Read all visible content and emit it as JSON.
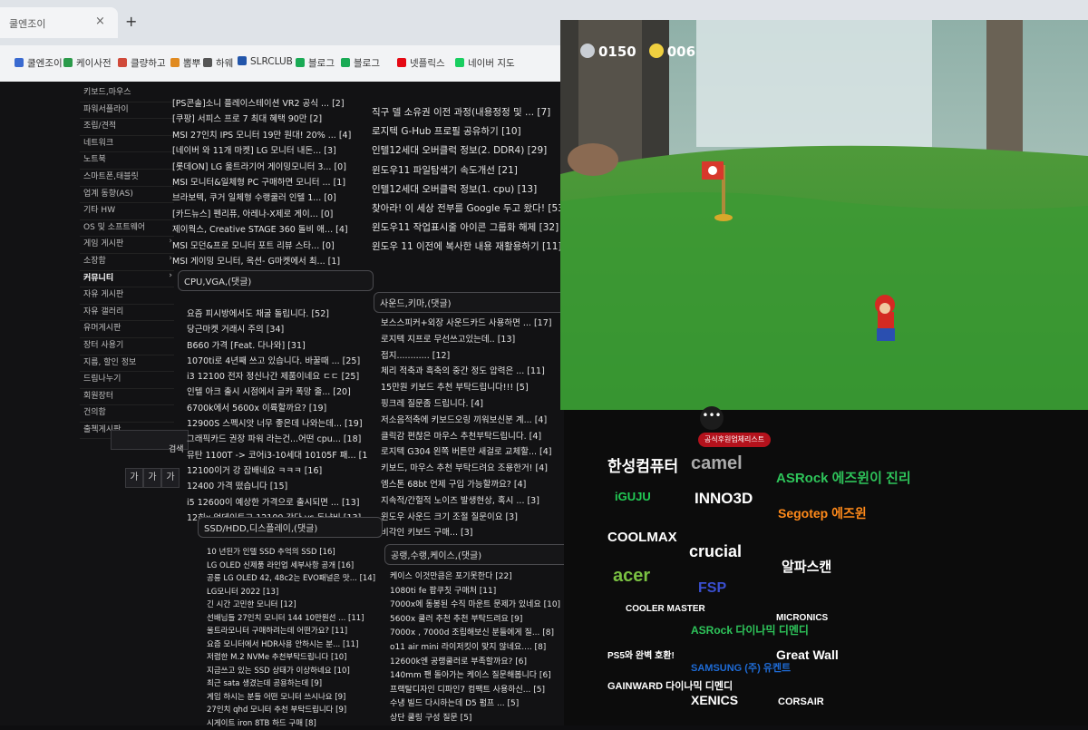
{
  "browser": {
    "tab_title": "쿨엔조이",
    "tab_close": "×",
    "new_tab": "+",
    "bookmarks": [
      {
        "label": "쿨엔조이",
        "color": "#3a6ad0"
      },
      {
        "label": "케이사전",
        "color": "#2b9a4a"
      },
      {
        "label": "클량하고",
        "color": "#d04a3a"
      },
      {
        "label": "뽐뿌",
        "color": "#e08a20"
      },
      {
        "label": "하웨",
        "color": "#555555"
      },
      {
        "label": "SLRCLUB",
        "color": "#2255aa"
      },
      {
        "label": "블로그",
        "color": "#1aaa55"
      },
      {
        "label": "블로그",
        "color": "#1aaa55"
      },
      {
        "label": "넷플릭스",
        "color": "#e50914"
      },
      {
        "label": "네이버 지도",
        "color": "#19ce60"
      }
    ]
  },
  "sidebar": {
    "items": [
      {
        "label": "키보드,마우스",
        "arrow": ""
      },
      {
        "label": "파워서플라이",
        "arrow": ""
      },
      {
        "label": "조립/견적",
        "arrow": ""
      },
      {
        "label": "네트워크",
        "arrow": ""
      },
      {
        "label": "노트북",
        "arrow": ""
      },
      {
        "label": "스마트폰,태블릿",
        "arrow": ""
      },
      {
        "label": "업계 동향(AS)",
        "arrow": ""
      },
      {
        "label": "기타 HW",
        "arrow": ""
      },
      {
        "label": "OS 및 소프트웨어",
        "arrow": ""
      },
      {
        "label": "게임 게시판",
        "arrow": "›"
      },
      {
        "label": "소장함",
        "arrow": "›"
      },
      {
        "label": "커뮤니티",
        "arrow": "›"
      },
      {
        "label": "자유 게시판",
        "arrow": ""
      },
      {
        "label": "자유 갤러리",
        "arrow": ""
      },
      {
        "label": "유머게시판",
        "arrow": ""
      },
      {
        "label": "장터 사용기",
        "arrow": ""
      },
      {
        "label": "지름, 할인 정보",
        "arrow": ""
      },
      {
        "label": "드림나누기",
        "arrow": ""
      },
      {
        "label": "회원장터",
        "arrow": ""
      },
      {
        "label": "건의함",
        "arrow": ""
      },
      {
        "label": "출첵게시판",
        "arrow": ""
      }
    ],
    "active_index": 11,
    "search_button": "검색",
    "pager": [
      "가",
      "가",
      "가"
    ]
  },
  "boards": {
    "top_left": [
      "[PS콘솔]소니 플레이스테이션 VR2 공식 ... [2]",
      "[쿠팡] 서피스 프로 7 최대 혜택 90만 [2]",
      "MSI 27인치 IPS 모니터 19만 원대! 20% ... [4]",
      "[네이버 와 11개 마켓] LG 모니터 내돈... [3]",
      "[롯데ON] LG 울트라기어 게이밍모니터 3... [0]",
      "MSI 모니터&일체형 PC 구매하면 모니터 ... [1]",
      "브라보텍, 쿠거 일체형 수랭쿨러 인텔 1... [0]",
      "[카드뉴스] 펜리퓨, 아레나-X제로 게이... [0]",
      "제이웍스, Creative STAGE 360 돌비 애... [4]",
      "MSI 모던&프로 모니터 포트 리뷰 스타... [0]",
      "MSI 게이밍 모니터, 옥션- G마켓에서 최... [1]"
    ],
    "top_right": [
      "직구 델 소유권 이전 과정(내용정정 및 ... [7]",
      "로지텍 G-Hub 프로필 공유하기 [10]",
      "인텔12세대 오버클럭 정보(2. DDR4) [29]",
      "윈도우11 파일탐색기 속도개선 [21]",
      "인텔12세대 오버클럭 정보(1. cpu) [13]",
      "찾아라! 이 세상 전부를 Google 두고 왔다! [53]",
      "윈도우11 작업표시줄 아이콘 그룹화 해제 [32]",
      "윈도우 11 이전에 복사한 내용 재활용하기 [11]"
    ],
    "cpu_title": "CPU,VGA,(댓글)",
    "cpu": [
      "요즘 피시방에서도 채굴 돌립니다. [52]",
      "당근마켓 거래시 주의 [34]",
      "B660 가격 [Feat. 다나와] [31]",
      "1070ti로 4년째 쓰고 있습니다. 바꿀때 ... [25]",
      "i3 12100 전자 정신나간 제품이네요 ㄷㄷ [25]",
      "인텔 아크 출시 시점에서 글카 폭망 줄... [20]",
      "6700k에서 5600x 이륙할까요? [19]",
      "12900S 스펙시앗 너무 좋은데 나와는데... [19]",
      "그래픽카드 권장 파워 라는건...어떤 cpu... [18]",
      "뮤탄 1100T -> 코어i3-10세대 10105F 패... [18]",
      "12100이거 강 잡배네요 ㅋㅋㅋ [16]",
      "12400 가격 떴습니다 [15]",
      "i5 12600이 예상한 가격으로 출시되면 ... [13]",
      "12히x 업데이트고 12100 간다 vs 돈냥비 [13]"
    ],
    "ssd_title": "SSD/HDD,디스플레이,(댓글)",
    "ssd": [
      "10 년된가 인텔 SSD 추억의 SSD [16]",
      "LG OLED 신제품 라인업 세부사항 공개 [16]",
      "공룡 LG OLED 42, 48c2는 EVO패널은 맛... [14]",
      "LG모니터 2022 [13]",
      "긴 시간 고민한 모니터 [12]",
      "선배님들 27인치 모니터 144 10만원선 ... [11]",
      "울트라모니터 구매하려는데 어떤가요? [11]",
      "요즘 모니터에서 HDR사용 안하시는 분... [11]",
      "저렴한 M.2 NVMe 추천부탁드립니다 [10]",
      "지금쓰고 있는 SSD 상태가 이상하네요 [10]",
      "최근 sata 생겼는데 공용하는데 [9]",
      "게임 하시는 분들 어떤 모니터 쓰시나요 [9]",
      "27인치 qhd 모니터 추천 부탁드립니다 [9]",
      "시게이트 iron 8TB 하드 구매 [8]"
    ],
    "sound_title": "사운드,키마,(댓글)",
    "sound": [
      "보스스피커+외장 사운드카드 사용하면 ... [17]",
      "로지텍 지프로 무선쓰고있는데.. [13]",
      "접지............ [12]",
      "체리 적축과 흑축의 중간 정도 압력은 ... [11]",
      "15만원 키보드 추천 부탁드립니다!!! [5]",
      "핑크레 질문좀 드립니다. [4]",
      "저소음적축에 키보드오링 끼워보신분 계... [4]",
      "클릭감 편찮은 마우스 추천부탁드립니다. [4]",
      "로지텍 G304 왼쪽 버튼만 새걸로 교체할... [4]",
      "키보드, 마우스 추천 부탁드려요 조용한거! [4]",
      "엠스톤 68bt 언제 구입 가능할까요? [4]",
      "지속적/간헐적 노이즈 발생현상, 혹시 ... [3]",
      "윈도우 사운드 크기 조절 질문이요 [3]",
      "비각인 키보드 구매... [3]"
    ],
    "case_title": "공랭,수랭,케이스,(댓글)",
    "case": [
      "케이스 이것만큼은 포기못한다 [22]",
      "1080ti fe 팝쿠칫 구매처 [11]",
      "7000x에 동봉된 수직 마운트 문제가 있네요 [10]",
      "5600x 쿨러 추천 추천 부탁드려요 [9]",
      "7000x , 7000d 조립해보신 분들에게 질... [8]",
      "o11 air mini 라이저킷이 맞지 않네요.... [8]",
      "12600k엔 공랭쿨러로 부족할까요? [6]",
      "140mm 팬 돌아가는 케이스 질문해봅니다 [6]",
      "프랙탈디자인 디파인7 컴팩트 사용하신... [5]",
      "수냉 빌드 다시하는데 D5 펌프 ... [5]",
      "상단 쿨링 구성 질문 [5]"
    ]
  },
  "game": {
    "coins": "0150",
    "moons": "006"
  },
  "banner": {
    "dots": "•••",
    "badge": "공식후원업체리스트",
    "logos": [
      {
        "text": "한성컴퓨터",
        "color": "#ffffff"
      },
      {
        "text": "camel",
        "color": "#aaaaaa"
      },
      {
        "text": "ASRock 에즈윈이 진리",
        "color": "#2ec45a"
      },
      {
        "text": "iGUJU",
        "color": "#22cc55"
      },
      {
        "text": "INNO3D",
        "color": "#ffffff"
      },
      {
        "text": "Segotep 에즈윈",
        "color": "#ff8a1a"
      },
      {
        "text": "COOLMAX",
        "color": "#ffffff"
      },
      {
        "text": "crucial",
        "color": "#ffffff"
      },
      {
        "text": "알파스캔",
        "color": "#ffffff"
      },
      {
        "text": "acer",
        "color": "#7ac142"
      },
      {
        "text": "FSP",
        "color": "#3a4fd0"
      },
      {
        "text": "MICRONICS",
        "color": "#ffffff"
      },
      {
        "text": "COOLER MASTER",
        "color": "#ffffff"
      },
      {
        "text": "ASRock 다이나믹 디멘디",
        "color": "#2ec45a"
      },
      {
        "text": "PS5와 완벽 호환!",
        "color": "#ffffff"
      },
      {
        "text": "Great Wall",
        "color": "#ffffff"
      },
      {
        "text": "SAMSUNG (주) 유켄트",
        "color": "#1e6bd6"
      },
      {
        "text": "GAINWARD 다이나믹 디멘디",
        "color": "#ffffff"
      },
      {
        "text": "XENICS",
        "color": "#ffffff"
      },
      {
        "text": "CORSAIR",
        "color": "#ffffff"
      }
    ]
  }
}
